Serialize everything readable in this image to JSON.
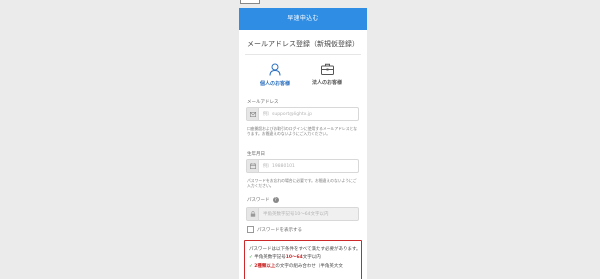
{
  "header": {
    "title": "早速申込む"
  },
  "section": {
    "title": "メールアドレス登録（新規仮登録）"
  },
  "account_types": {
    "personal_label": "個人のお客様",
    "corporate_label": "法人のお客様"
  },
  "email": {
    "label": "メールアドレス",
    "placeholder": "例）support@lightx.jp",
    "help": "口座開設およびお取引のログインに使用するメールアドレスとなります。お間違えのないようにご入力ください。"
  },
  "birthday": {
    "label": "生年月日",
    "placeholder": "例）19880101",
    "help": "パスワードをお忘れの場合に必要です。お間違えのないようにご入力ください。"
  },
  "password": {
    "label": "パスワード",
    "help_icon": "?",
    "placeholder": "半角英数字記号10〜64文字以内",
    "show_label": "パスワードを表示する"
  },
  "rules": {
    "intro": "パスワードは以下条件をすべて満たす必要があります。",
    "item1_mark": "✓",
    "item1_text": "半角英数字記号",
    "item1_highlight": "10〜64",
    "item1_suffix": "文字以内",
    "item2_mark": "✓",
    "item2_highlight": "2種類以上",
    "item2_text": "の文字の組み合わせ（半角英大文"
  },
  "colors": {
    "header_bg": "#2f8de4",
    "accent_blue": "#2a6fbf",
    "error_red": "#cc2a2a",
    "ok_green": "#2c9a2c"
  },
  "icons": {
    "personal": "person-icon",
    "corporate": "briefcase-icon",
    "email": "envelope-icon",
    "birthday": "calendar-icon",
    "password": "lock-icon"
  }
}
